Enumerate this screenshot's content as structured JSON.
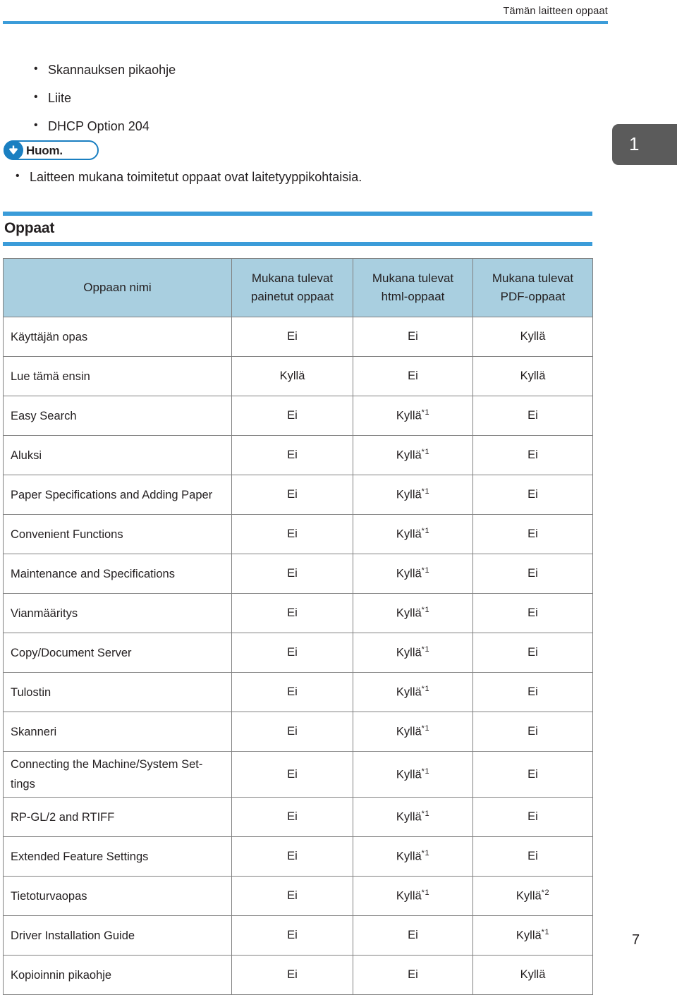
{
  "header": {
    "running_title": "Tämän laitteen oppaat",
    "rule_color": "#3b9cd9"
  },
  "page_tab": {
    "number": "1",
    "background_color": "#5b5b5b"
  },
  "intro_list": {
    "items": [
      {
        "label": "Skannauksen pikaohje"
      },
      {
        "label": "Liite"
      },
      {
        "label": "DHCP Option 204"
      }
    ]
  },
  "callout": {
    "label": "Huom.",
    "icon": "down-arrow-icon",
    "accent_color": "#1a7fc1",
    "notes": [
      {
        "label": "Laitteen mukana toimitetut oppaat ovat laitetyyppikohtaisia."
      }
    ]
  },
  "section": {
    "title": "Oppaat",
    "rule_color": "#3b9cd9"
  },
  "table": {
    "header_background": "#a9cfe0",
    "columns": [
      "Oppaan nimi",
      "Mukana tulevat painetut oppaat",
      "Mukana tulevat html-oppaat",
      "Mukana tulevat PDF-oppaat"
    ],
    "columns_lines": [
      [
        "Oppaan nimi"
      ],
      [
        "Mukana tulevat",
        "painetut oppaat"
      ],
      [
        "Mukana tulevat",
        "html-oppaat"
      ],
      [
        "Mukana tulevat",
        "PDF-oppaat"
      ]
    ],
    "rows": [
      {
        "name": "Käyttäjän opas",
        "printed": "Ei",
        "html": "Ei",
        "pdf": "Kyllä",
        "printed_sup": "",
        "html_sup": "",
        "pdf_sup": ""
      },
      {
        "name": "Lue tämä ensin",
        "printed": "Kyllä",
        "html": "Ei",
        "pdf": "Kyllä",
        "printed_sup": "",
        "html_sup": "",
        "pdf_sup": ""
      },
      {
        "name": "Easy Search",
        "printed": "Ei",
        "html": "Kyllä",
        "pdf": "Ei",
        "printed_sup": "",
        "html_sup": "*1",
        "pdf_sup": ""
      },
      {
        "name": "Aluksi",
        "printed": "Ei",
        "html": "Kyllä",
        "pdf": "Ei",
        "printed_sup": "",
        "html_sup": "*1",
        "pdf_sup": ""
      },
      {
        "name": "Paper Specifications and Adding Paper",
        "printed": "Ei",
        "html": "Kyllä",
        "pdf": "Ei",
        "printed_sup": "",
        "html_sup": "*1",
        "pdf_sup": ""
      },
      {
        "name": "Convenient Functions",
        "printed": "Ei",
        "html": "Kyllä",
        "pdf": "Ei",
        "printed_sup": "",
        "html_sup": "*1",
        "pdf_sup": ""
      },
      {
        "name": "Maintenance and Specifications",
        "printed": "Ei",
        "html": "Kyllä",
        "pdf": "Ei",
        "printed_sup": "",
        "html_sup": "*1",
        "pdf_sup": ""
      },
      {
        "name": "Vianmääritys",
        "printed": "Ei",
        "html": "Kyllä",
        "pdf": "Ei",
        "printed_sup": "",
        "html_sup": "*1",
        "pdf_sup": ""
      },
      {
        "name": "Copy/Document Server",
        "printed": "Ei",
        "html": "Kyllä",
        "pdf": "Ei",
        "printed_sup": "",
        "html_sup": "*1",
        "pdf_sup": ""
      },
      {
        "name": "Tulostin",
        "printed": "Ei",
        "html": "Kyllä",
        "pdf": "Ei",
        "printed_sup": "",
        "html_sup": "*1",
        "pdf_sup": ""
      },
      {
        "name": "Skanneri",
        "printed": "Ei",
        "html": "Kyllä",
        "pdf": "Ei",
        "printed_sup": "",
        "html_sup": "*1",
        "pdf_sup": ""
      },
      {
        "name": "Connecting the Machine/System Set-tings",
        "printed": "Ei",
        "html": "Kyllä",
        "pdf": "Ei",
        "printed_sup": "",
        "html_sup": "*1",
        "pdf_sup": ""
      },
      {
        "name": "RP-GL/2 and RTIFF",
        "printed": "Ei",
        "html": "Kyllä",
        "pdf": "Ei",
        "printed_sup": "",
        "html_sup": "*1",
        "pdf_sup": ""
      },
      {
        "name": "Extended Feature Settings",
        "printed": "Ei",
        "html": "Kyllä",
        "pdf": "Ei",
        "printed_sup": "",
        "html_sup": "*1",
        "pdf_sup": ""
      },
      {
        "name": "Tietoturvaopas",
        "printed": "Ei",
        "html": "Kyllä",
        "pdf": "Kyllä",
        "printed_sup": "",
        "html_sup": "*1",
        "pdf_sup": "*2"
      },
      {
        "name": "Driver Installation Guide",
        "printed": "Ei",
        "html": "Ei",
        "pdf": "Kyllä",
        "printed_sup": "",
        "html_sup": "",
        "pdf_sup": "*1"
      },
      {
        "name": "Kopioinnin pikaohje",
        "printed": "Ei",
        "html": "Ei",
        "pdf": "Kyllä",
        "printed_sup": "",
        "html_sup": "",
        "pdf_sup": ""
      }
    ]
  },
  "footer": {
    "page_number": "7"
  }
}
